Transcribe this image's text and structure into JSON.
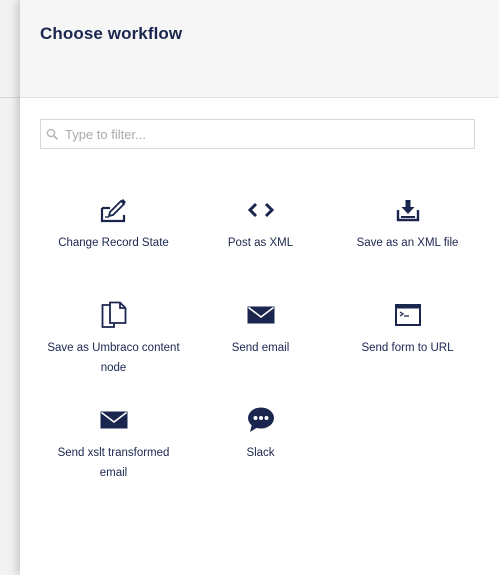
{
  "dialog": {
    "title": "Choose workflow"
  },
  "filter": {
    "placeholder": "Type to filter...",
    "value": "",
    "icon": "search-icon"
  },
  "workflows": [
    {
      "label": "Change Record State",
      "icon": "edit-document-icon"
    },
    {
      "label": "Post as XML",
      "icon": "code-icon"
    },
    {
      "label": "Save as an XML file",
      "icon": "download-icon"
    },
    {
      "label": "Save as Umbraco content node",
      "icon": "documents-icon"
    },
    {
      "label": "Send email",
      "icon": "envelope-icon"
    },
    {
      "label": "Send form to URL",
      "icon": "terminal-icon"
    },
    {
      "label": "Send xslt transformed email",
      "icon": "envelope-icon"
    },
    {
      "label": "Slack",
      "icon": "chat-bubble-icon"
    }
  ],
  "colors": {
    "text": "#1b264f",
    "header_background": "#f6f6f6",
    "border": "#d8d7d9"
  }
}
